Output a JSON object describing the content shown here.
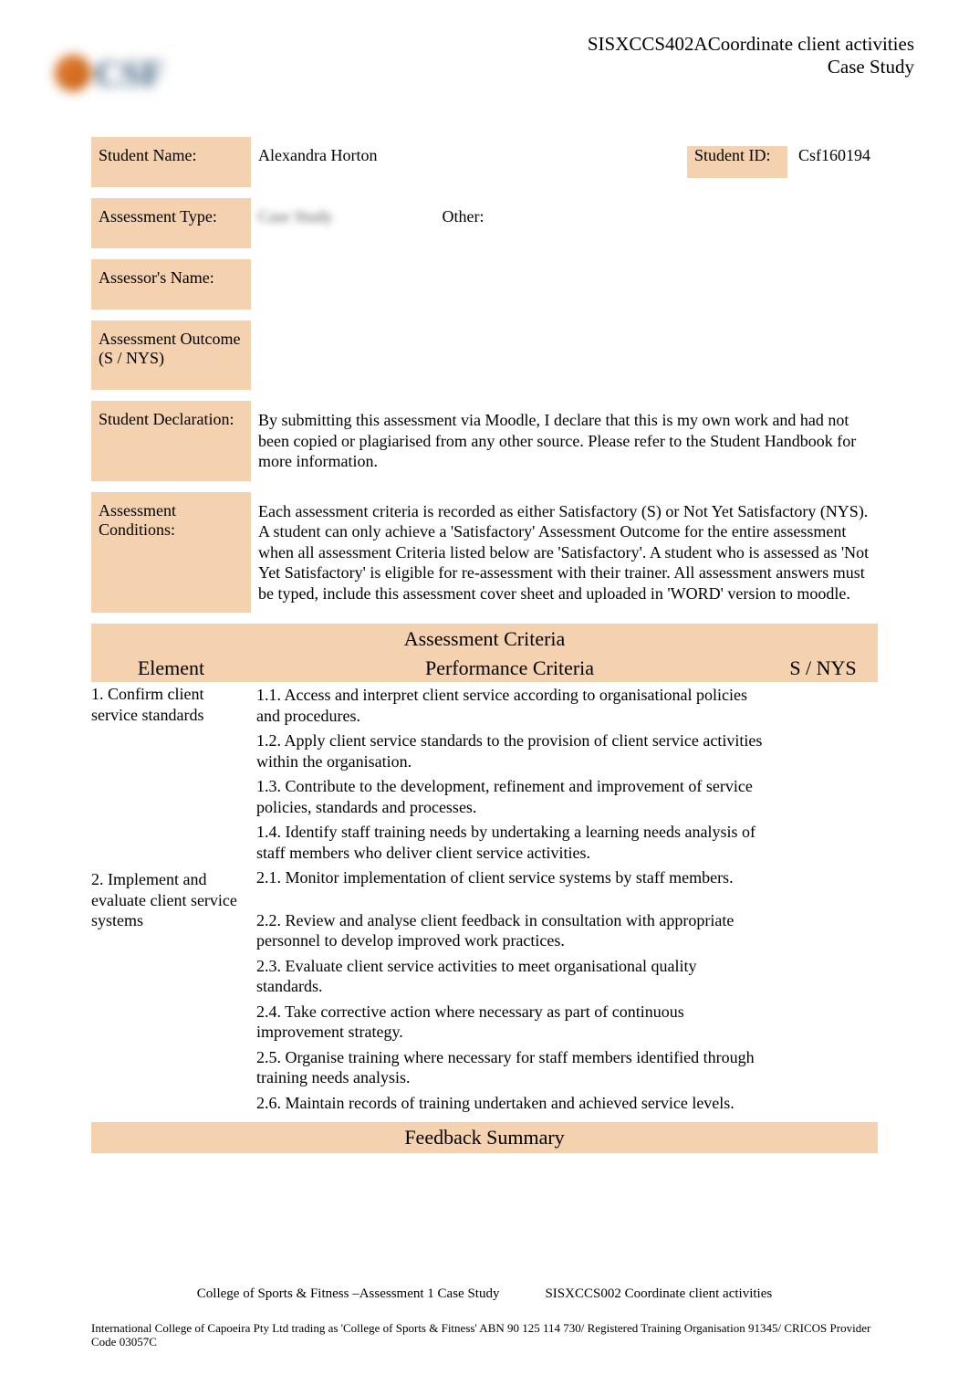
{
  "header": {
    "unit_code": "SISXCCS402A",
    "unit_title": "Coordinate client activities",
    "subtitle": "Case Study"
  },
  "fields": {
    "student_name_label": "Student Name:",
    "student_name": "Alexandra Horton",
    "student_id_label": "Student ID:",
    "student_id": "Csf160194",
    "assessment_type_label": "Assessment Type:",
    "assessment_type_blur": "Case Study",
    "other_label": "Other:",
    "other_value": "",
    "assessor_label": "Assessor's Name:",
    "assessor_value": "",
    "outcome_label": "Assessment Outcome (S / NYS)",
    "outcome_value": "",
    "declaration_label": "Student Declaration:",
    "declaration_text": "By submitting this assessment via Moodle, I declare that this is my own work and had not been copied or plagiarised from any other source. Please refer to the Student Handbook for more information.",
    "conditions_label": "Assessment Conditions:",
    "conditions_text": "Each assessment criteria is recorded as either Satisfactory (S) or Not Yet Satisfactory (NYS). A student can only achieve a 'Satisfactory' Assessment Outcome for the entire assessment when all assessment Criteria listed below are 'Satisfactory'. A student who is assessed as 'Not Yet Satisfactory' is eligible for re-assessment with their trainer. All assessment answers must be typed, include this assessment cover sheet and uploaded in 'WORD' version to moodle."
  },
  "criteria": {
    "section_title": "Assessment Criteria",
    "head_element": "Element",
    "head_pc": "Performance Criteria",
    "head_snys": "S / NYS",
    "elements": [
      {
        "title": "1. Confirm client service standards",
        "items": [
          "1.1. Access and interpret client service according to organisational policies and procedures.",
          "1.2. Apply client service standards to the provision of client service activities within the organisation.",
          "1.3. Contribute to the development, refinement and improvement of service policies, standards and processes.",
          "1.4. Identify staff training needs by undertaking a learning needs analysis of staff members who deliver client service activities."
        ]
      },
      {
        "title": "2. Implement and evaluate client service systems",
        "items": [
          "2.1. Monitor implementation of client service systems by staff members.",
          "2.2. Review and analyse client feedback in consultation with appropriate personnel to develop improved work practices.",
          "2.3. Evaluate client service activities to meet organisational quality standards.",
          "2.4. Take corrective action where necessary as part of continuous improvement strategy.",
          "2.5. Organise training where necessary for staff members identified through training needs analysis.",
          "2.6. Maintain records of training undertaken and achieved service levels."
        ]
      }
    ],
    "feedback_title": "Feedback Summary"
  },
  "footer": {
    "left": "College of Sports & Fitness –Assessment 1 Case Study",
    "right": "SISXCCS002 Coordinate client activities",
    "legal": "International College of Capoeira Pty Ltd trading as 'College of Sports & Fitness' ABN 90 125 114 730/ Registered Training Organisation 91345/ CRICOS Provider Code 03057C"
  }
}
